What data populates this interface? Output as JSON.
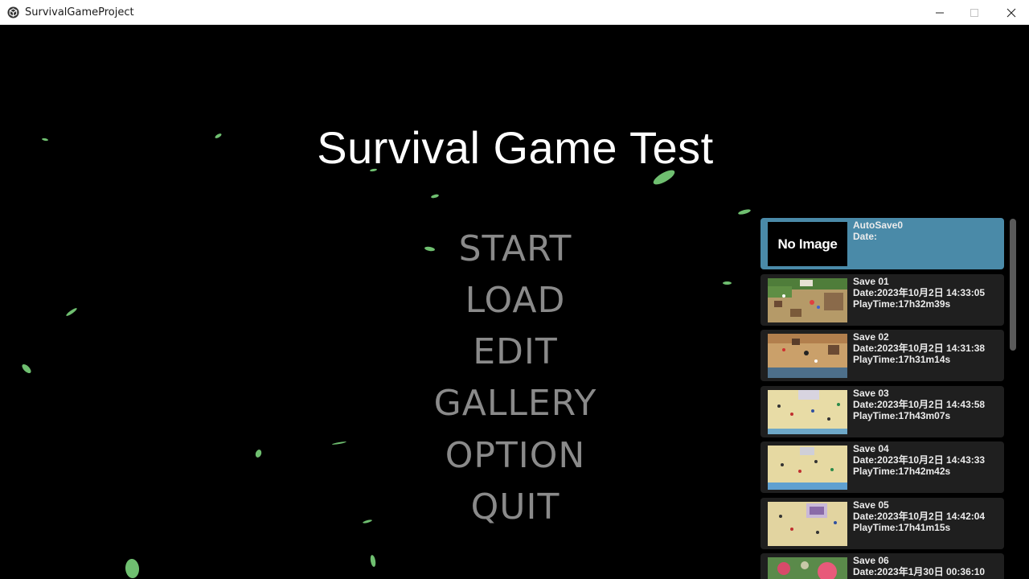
{
  "window": {
    "title": "SurvivalGameProject",
    "app_icon": "unity-cube-icon",
    "controls": [
      "minimize-icon",
      "maximize-icon",
      "close-icon"
    ]
  },
  "game": {
    "title": "Survival Game Test",
    "menu": [
      {
        "label": "START"
      },
      {
        "label": "LOAD"
      },
      {
        "label": "EDIT"
      },
      {
        "label": "GALLERY"
      },
      {
        "label": "OPTION"
      },
      {
        "label": "QUIT"
      }
    ],
    "colors": {
      "menu_text": "#8a8a8a",
      "selected_slot": "#4a8aa8",
      "slot_bg": "#1f1f1f",
      "leaf": "#6fbf70"
    }
  },
  "saves": [
    {
      "name": "AutoSave0",
      "date": "Date:",
      "playtime": "",
      "thumbnail": "No Image",
      "selected": true
    },
    {
      "name": "Save 01",
      "date": "Date:2023年10月2日 14:33:05",
      "playtime": "PlayTime:17h32m39s"
    },
    {
      "name": "Save 02",
      "date": "Date:2023年10月2日 14:31:38",
      "playtime": "PlayTime:17h31m14s"
    },
    {
      "name": "Save 03",
      "date": "Date:2023年10月2日 14:43:58",
      "playtime": "PlayTime:17h43m07s"
    },
    {
      "name": "Save 04",
      "date": "Date:2023年10月2日 14:43:33",
      "playtime": "PlayTime:17h42m42s"
    },
    {
      "name": "Save 05",
      "date": "Date:2023年10月2日 14:42:04",
      "playtime": "PlayTime:17h41m15s"
    },
    {
      "name": "Save 06",
      "date": "Date:2023年1月30日 00:36:10",
      "playtime": ""
    }
  ]
}
